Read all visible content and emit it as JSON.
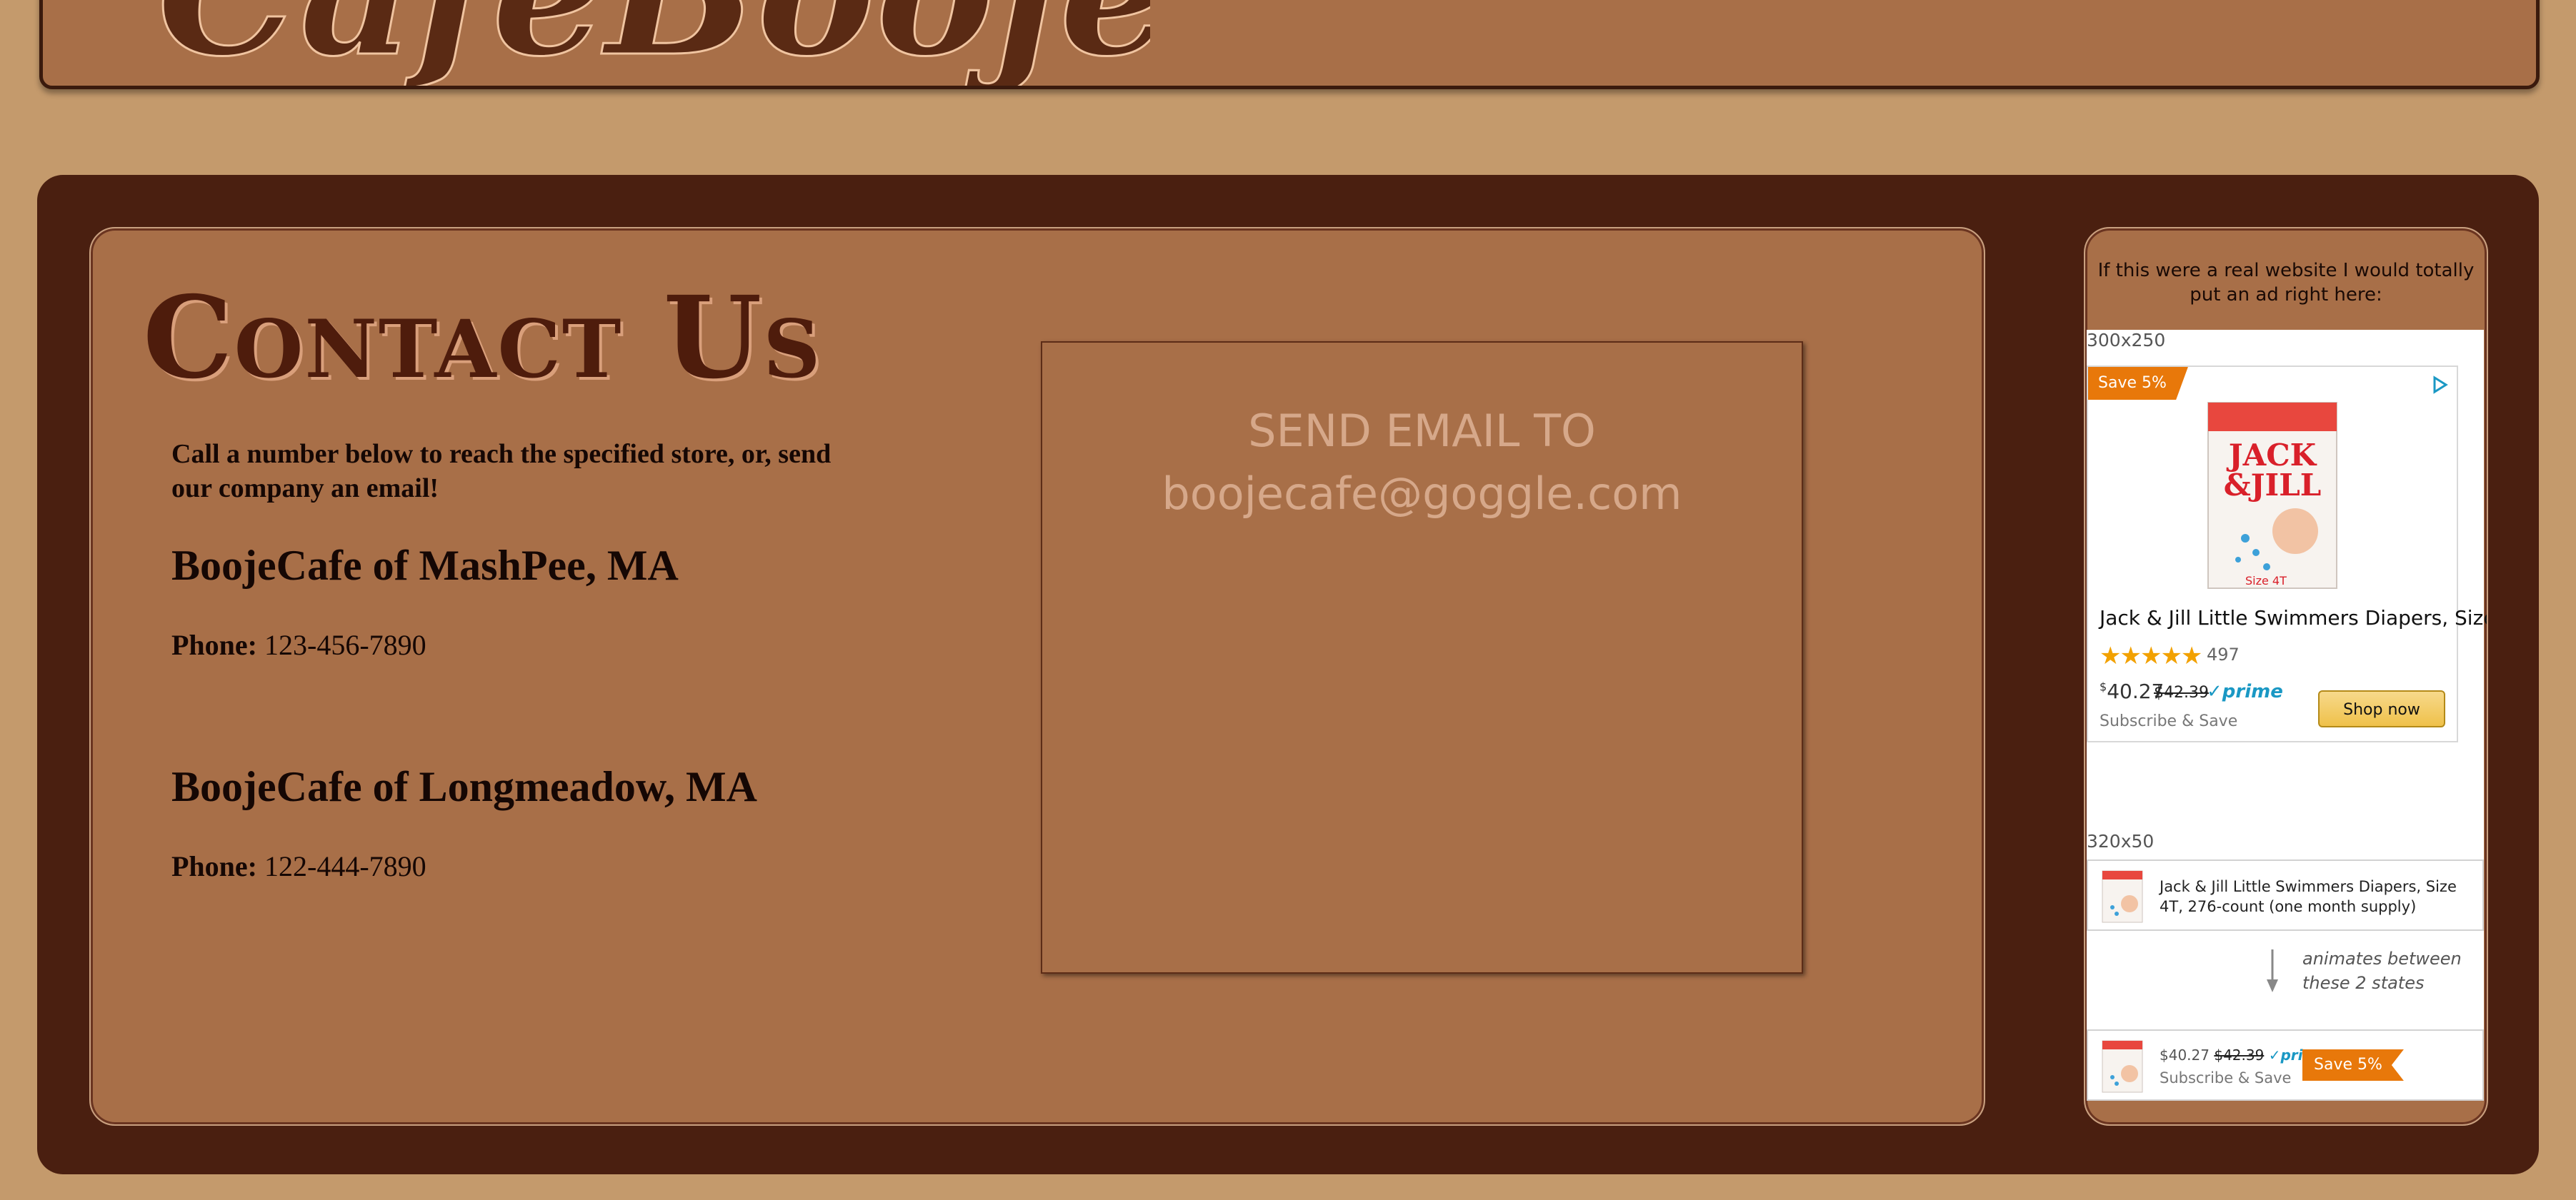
{
  "header": {
    "logo_text": "CafeBooje"
  },
  "contact": {
    "title": "Contact Us",
    "intro": "Call a number below to reach the specified store, or, send our company an email!",
    "stores": [
      {
        "name": "BoojeCafe of MashPee, MA",
        "phone_label": "Phone:",
        "phone": "123-456-7890"
      },
      {
        "name": "BoojeCafe of Longmeadow, MA",
        "phone_label": "Phone:",
        "phone": "122-444-7890"
      }
    ],
    "email_line1": "SEND EMAIL TO",
    "email_line2": "boojecafe@goggle.com"
  },
  "ad": {
    "note": "If this were a real website I would totally put an ad right here:",
    "size_1": "300x250",
    "save_tag": "Save 5%",
    "product_title": "Jack & Jill Little Swimmers Diapers, Size...",
    "stars": "★★★★★",
    "rating": 4.5,
    "rating_count": "497",
    "price_sup": "$",
    "price": "40.27",
    "old_price": "$42.39",
    "prime": "✓prime",
    "subscribe": "Subscribe & Save",
    "shop_button": "Shop now",
    "size_2": "320x50",
    "banner_title": "Jack & Jill Little Swimmers Diapers, Size 4T, 276-count (one month supply)",
    "anim_note_1": "animates between",
    "anim_note_2": "these 2 states",
    "banner2_price": "$40.27",
    "banner2_old": "$42.39",
    "banner2_prime": "✓prime",
    "banner2_subscribe": "Subscribe & Save",
    "banner2_save": "Save 5%"
  },
  "colors": {
    "background": "#c49a6c",
    "panel": "#a86f48",
    "frame": "#4a1f10",
    "title": "#4e1c0c",
    "accent_orange": "#e8780a"
  }
}
